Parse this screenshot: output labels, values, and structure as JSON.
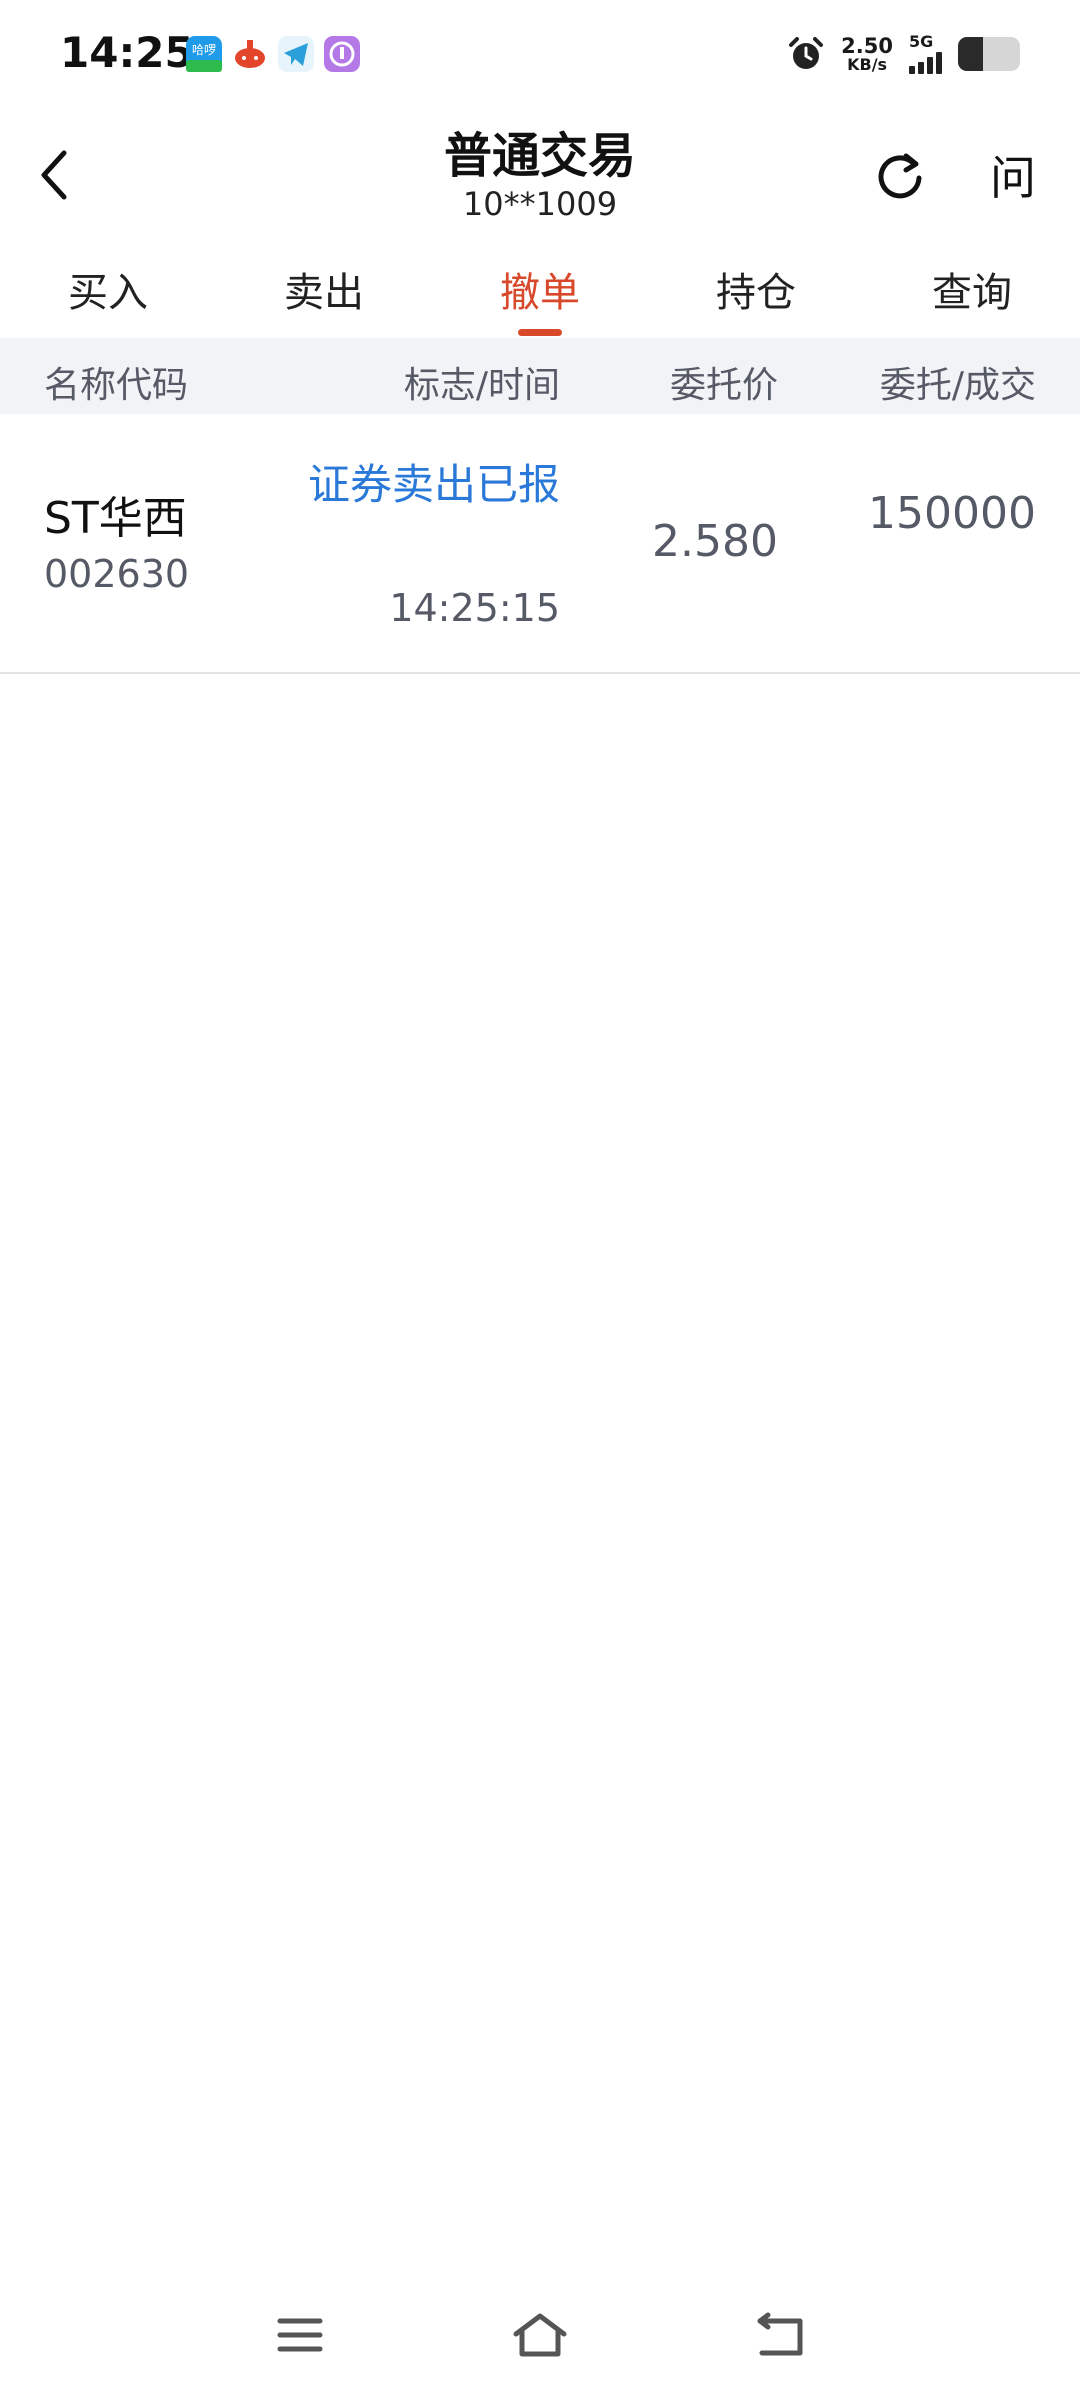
{
  "status_bar": {
    "time": "14:25",
    "net_speed_value": "2.50",
    "net_speed_unit": "KB/s",
    "network_type": "5G",
    "battery_percent": 40,
    "notification_icons": [
      "hello-bike-icon",
      "red-app-icon",
      "telegram-icon",
      "purple-app-icon"
    ]
  },
  "header": {
    "title": "普通交易",
    "account": "10**1009",
    "ask_label": "问"
  },
  "tabs": [
    {
      "label": "买入",
      "active": false
    },
    {
      "label": "卖出",
      "active": false
    },
    {
      "label": "撤单",
      "active": true
    },
    {
      "label": "持仓",
      "active": false
    },
    {
      "label": "查询",
      "active": false
    }
  ],
  "columns": {
    "name_code": "名称代码",
    "flag_time": "标志/时间",
    "price": "委托价",
    "qty": "委托/成交"
  },
  "orders": [
    {
      "name": "ST华西",
      "code": "002630",
      "status": "证券卖出已报",
      "time": "14:25:15",
      "price": "2.580",
      "qty": "150000"
    }
  ],
  "colors": {
    "accent": "#d8482a",
    "status_blue": "#2a79d8",
    "header_bg": "#f2f3f6",
    "secondary_text": "#555a66"
  }
}
